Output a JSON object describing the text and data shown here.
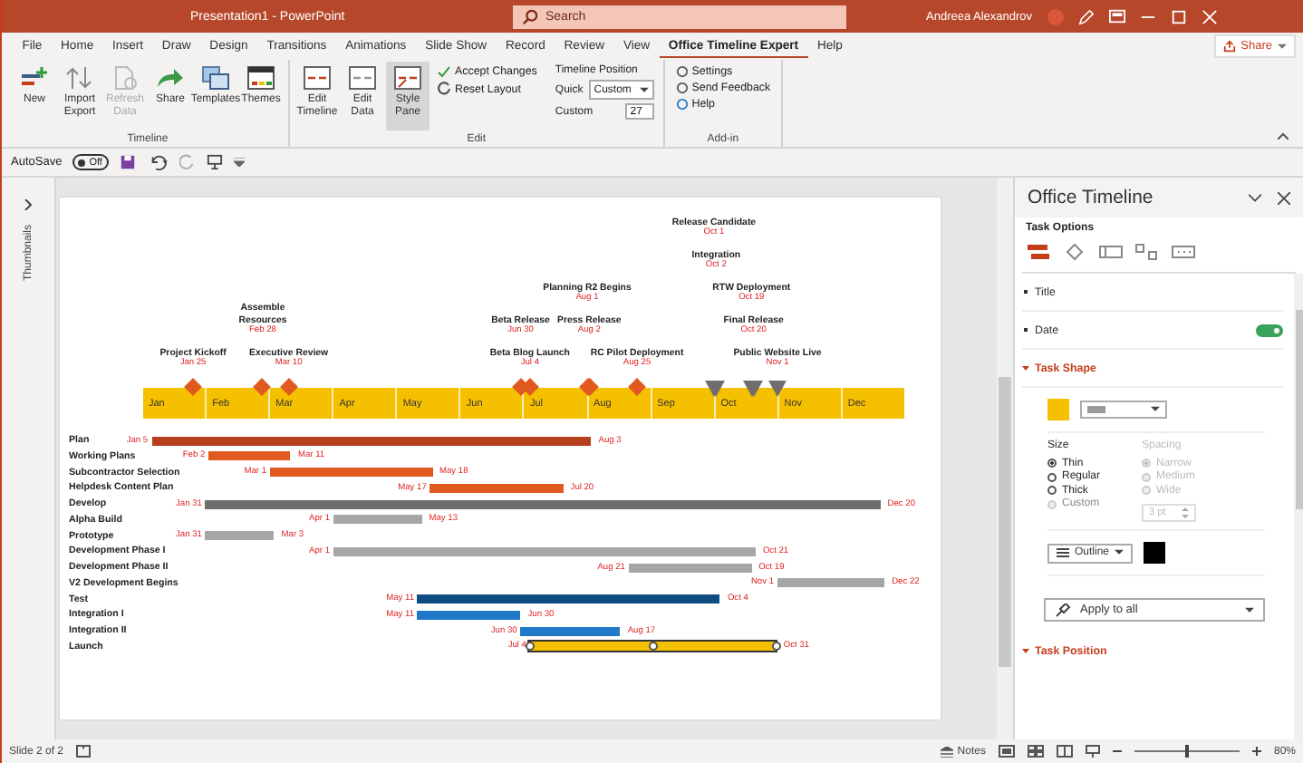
{
  "window": {
    "title": "Presentation1  -  PowerPoint",
    "search_placeholder": "Search",
    "user": "Andreea Alexandrov"
  },
  "tabs": [
    {
      "label": "File",
      "selected": false
    },
    {
      "label": "Home",
      "selected": false
    },
    {
      "label": "Insert",
      "selected": false
    },
    {
      "label": "Draw",
      "selected": false
    },
    {
      "label": "Design",
      "selected": false
    },
    {
      "label": "Transitions",
      "selected": false
    },
    {
      "label": "Animations",
      "selected": false
    },
    {
      "label": "Slide Show",
      "selected": false
    },
    {
      "label": "Record",
      "selected": false
    },
    {
      "label": "Review",
      "selected": false
    },
    {
      "label": "View",
      "selected": false
    },
    {
      "label": "Office Timeline Expert",
      "selected": true
    },
    {
      "label": "Help",
      "selected": false
    }
  ],
  "share_button": "Share",
  "ribbon": {
    "timeline_group": {
      "label": "Timeline",
      "buttons": [
        {
          "label": "New",
          "disabled": false
        },
        {
          "label": "Import Export",
          "disabled": false
        },
        {
          "label": "Refresh Data",
          "disabled": true
        },
        {
          "label": "Share",
          "disabled": false
        },
        {
          "label": "Templates",
          "disabled": false
        },
        {
          "label": "Themes",
          "disabled": false
        }
      ]
    },
    "edit_group": {
      "label": "Edit",
      "buttons": [
        {
          "label": "Edit Timeline",
          "selected": false
        },
        {
          "label": "Edit Data",
          "selected": false
        },
        {
          "label": "Style Pane",
          "selected": true
        }
      ],
      "commands": [
        "Accept Changes",
        "Reset Layout"
      ],
      "position": {
        "heading": "Timeline Position",
        "quick_label": "Quick",
        "quick_value": "Custom",
        "custom_label": "Custom",
        "custom_value": "27"
      }
    },
    "addin_group": {
      "label": "Add-in",
      "commands": [
        "Settings",
        "Send Feedback",
        "Help"
      ]
    }
  },
  "quick_access": {
    "autosave_label": "AutoSave",
    "autosave_on": false,
    "autosave_state": "Off"
  },
  "thumbnails_label": "Thumbnails",
  "timeline": {
    "months": [
      "Jan",
      "Feb",
      "Mar",
      "Apr",
      "May",
      "Jun",
      "Jul",
      "Aug",
      "Sep",
      "Oct",
      "Nov",
      "Dec"
    ],
    "milestones": [
      {
        "title": "Project Kickoff",
        "date": "Jan 25",
        "kind": "diamond"
      },
      {
        "title": "Assemble Resources",
        "date": "Feb 28",
        "kind": "diamond"
      },
      {
        "title": "Executive Review",
        "date": "Mar 10",
        "kind": "diamond"
      },
      {
        "title": "Beta Release",
        "date": "Jun 30",
        "kind": "diamond"
      },
      {
        "title": "Beta Blog Launch",
        "date": "Jul 4",
        "kind": "diamond"
      },
      {
        "title": "Planning R2 Begins",
        "date": "Aug 1",
        "kind": "diamond"
      },
      {
        "title": "Press Release",
        "date": "Aug 2",
        "kind": "diamond"
      },
      {
        "title": "RC Pilot Deployment",
        "date": "Aug 25",
        "kind": "diamond"
      },
      {
        "title": "Release Candidate",
        "date": "Oct 1",
        "kind": "triangle"
      },
      {
        "title": "Integration",
        "date": "Oct 2",
        "kind": "triangle"
      },
      {
        "title": "RTW Deployment",
        "date": "Oct 19",
        "kind": "triangle"
      },
      {
        "title": "Final Release",
        "date": "Oct 20",
        "kind": "triangle"
      },
      {
        "title": "Public Website Live",
        "date": "Nov 1",
        "kind": "triangle"
      }
    ],
    "tasks": [
      {
        "title": "Plan",
        "start": "Jan 5",
        "end": "Aug 3",
        "color": "#b5401b",
        "selected": false
      },
      {
        "title": "Working Plans",
        "start": "Feb 2",
        "end": "Mar 11",
        "color": "#e05a1f",
        "selected": false
      },
      {
        "title": "Subcontractor Selection",
        "start": "Mar 1",
        "end": "May 18",
        "color": "#e05a1f",
        "selected": false
      },
      {
        "title": "Helpdesk Content Plan",
        "start": "May 17",
        "end": "Jul 20",
        "color": "#e05a1f",
        "selected": false
      },
      {
        "title": "Develop",
        "start": "Jan 31",
        "end": "Dec 20",
        "color": "#6e6e6e",
        "selected": false
      },
      {
        "title": "Alpha Build",
        "start": "Apr 1",
        "end": "May 13",
        "color": "#a6a6a6",
        "selected": false
      },
      {
        "title": "Prototype",
        "start": "Jan 31",
        "end": "Mar 3",
        "color": "#a6a6a6",
        "selected": false
      },
      {
        "title": "Development Phase I",
        "start": "Apr 1",
        "end": "Oct 21",
        "color": "#a6a6a6",
        "selected": false
      },
      {
        "title": "Development Phase II",
        "start": "Aug 21",
        "end": "Oct 19",
        "color": "#a6a6a6",
        "selected": false
      },
      {
        "title": "V2 Development Begins",
        "start": "Nov 1",
        "end": "Dec 22",
        "color": "#a6a6a6",
        "selected": false
      },
      {
        "title": "Test",
        "start": "May 11",
        "end": "Oct 4",
        "color": "#0f4c81",
        "selected": false
      },
      {
        "title": "Integration I",
        "start": "May 11",
        "end": "Jun 30",
        "color": "#1f78c8",
        "selected": false
      },
      {
        "title": "Integration II",
        "start": "Jun 30",
        "end": "Aug 17",
        "color": "#1f78c8",
        "selected": false
      },
      {
        "title": "Launch",
        "start": "Jul 4",
        "end": "Oct 31",
        "color": "#f5c000",
        "selected": true
      }
    ]
  },
  "pane": {
    "title": "Office Timeline",
    "subtitle": "Task Options",
    "option_tabs": [
      {
        "selected": true
      },
      {
        "selected": false
      },
      {
        "selected": false
      },
      {
        "selected": false
      },
      {
        "selected": false
      }
    ],
    "sections": [
      {
        "title": "Title",
        "expanded": false,
        "kind": "plain"
      },
      {
        "title": "Date",
        "expanded": false,
        "kind": "toggle",
        "on": true
      },
      {
        "title": "Task Shape",
        "expanded": true,
        "kind": "plain"
      }
    ],
    "size": {
      "label": "Size",
      "options": [
        {
          "label": "Thin",
          "selected": true,
          "disabled": false
        },
        {
          "label": "Regular",
          "selected": false,
          "disabled": false
        },
        {
          "label": "Thick",
          "selected": false,
          "disabled": false
        },
        {
          "label": "Custom",
          "selected": false,
          "disabled": true
        }
      ]
    },
    "spacing": {
      "label": "Spacing",
      "disabled": true,
      "options": [
        {
          "label": "Narrow",
          "selected": true
        },
        {
          "label": "Medium",
          "selected": false
        },
        {
          "label": "Wide",
          "selected": false
        }
      ],
      "value": "3 pt"
    },
    "outline_button": "Outline",
    "apply_button": "Apply to all",
    "last_section": {
      "title": "Task Position",
      "expanded": true
    }
  },
  "status_bar": {
    "slide": "Slide 2 of 2",
    "notes": "Notes",
    "zoom": "80%",
    "zoom_slider": {
      "level": 0.5
    }
  }
}
